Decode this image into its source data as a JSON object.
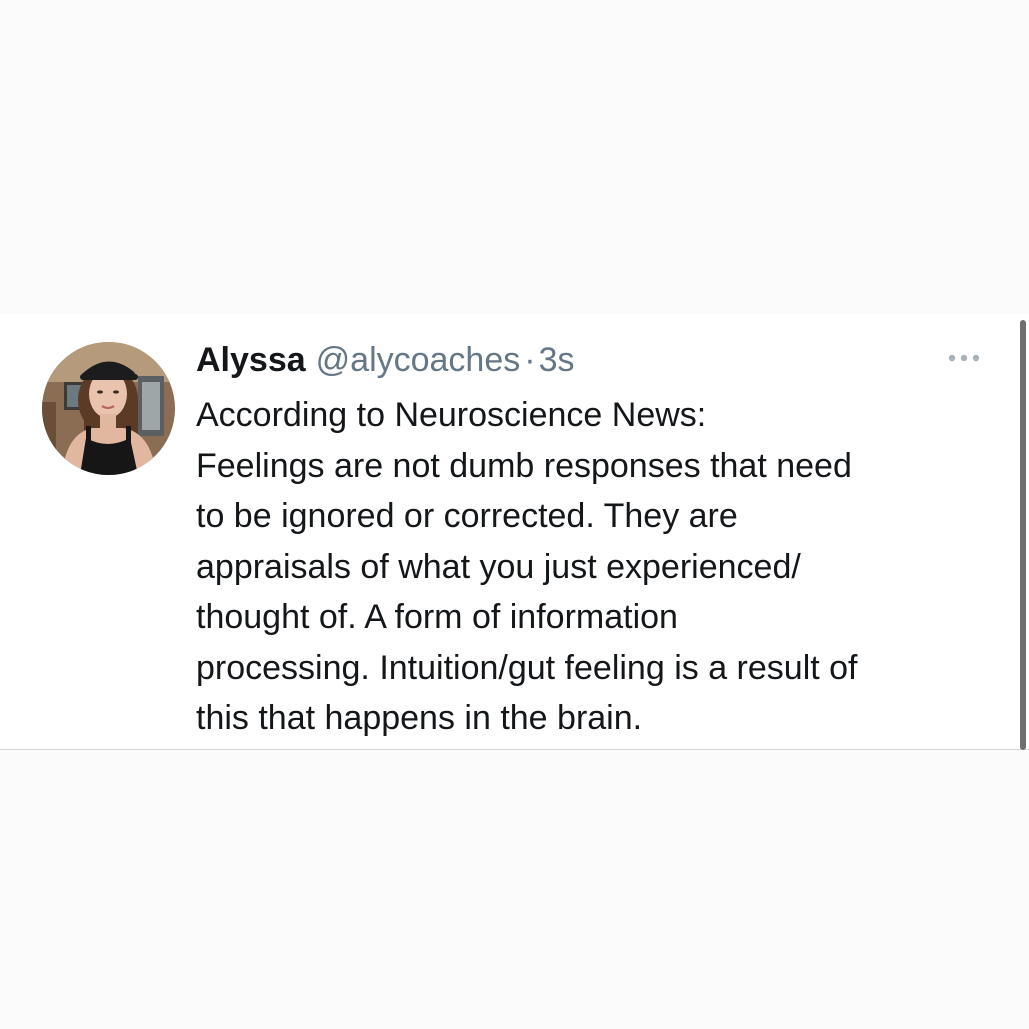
{
  "tweet": {
    "author": {
      "display_name": "Alyssa",
      "handle": "@alycoaches",
      "avatar": "profile-photo"
    },
    "separator": "·",
    "timestamp": "3s",
    "more_icon": "more-horizontal-icon",
    "text_lines": [
      "According to Neuroscience News:",
      "Feelings are not dumb responses that need",
      "to be ignored or corrected. They are",
      "appraisals of what you just experienced/",
      "thought of. A form of information",
      "processing. Intuition/gut feeling is a result of",
      "this that happens in the brain."
    ]
  },
  "colors": {
    "page_background": "#fbfbfb",
    "card_background": "#ffffff",
    "primary_text": "#14171a",
    "secondary_text": "#657786",
    "divider": "#d4d4d4",
    "scrollbar": "#6f6f6f"
  }
}
